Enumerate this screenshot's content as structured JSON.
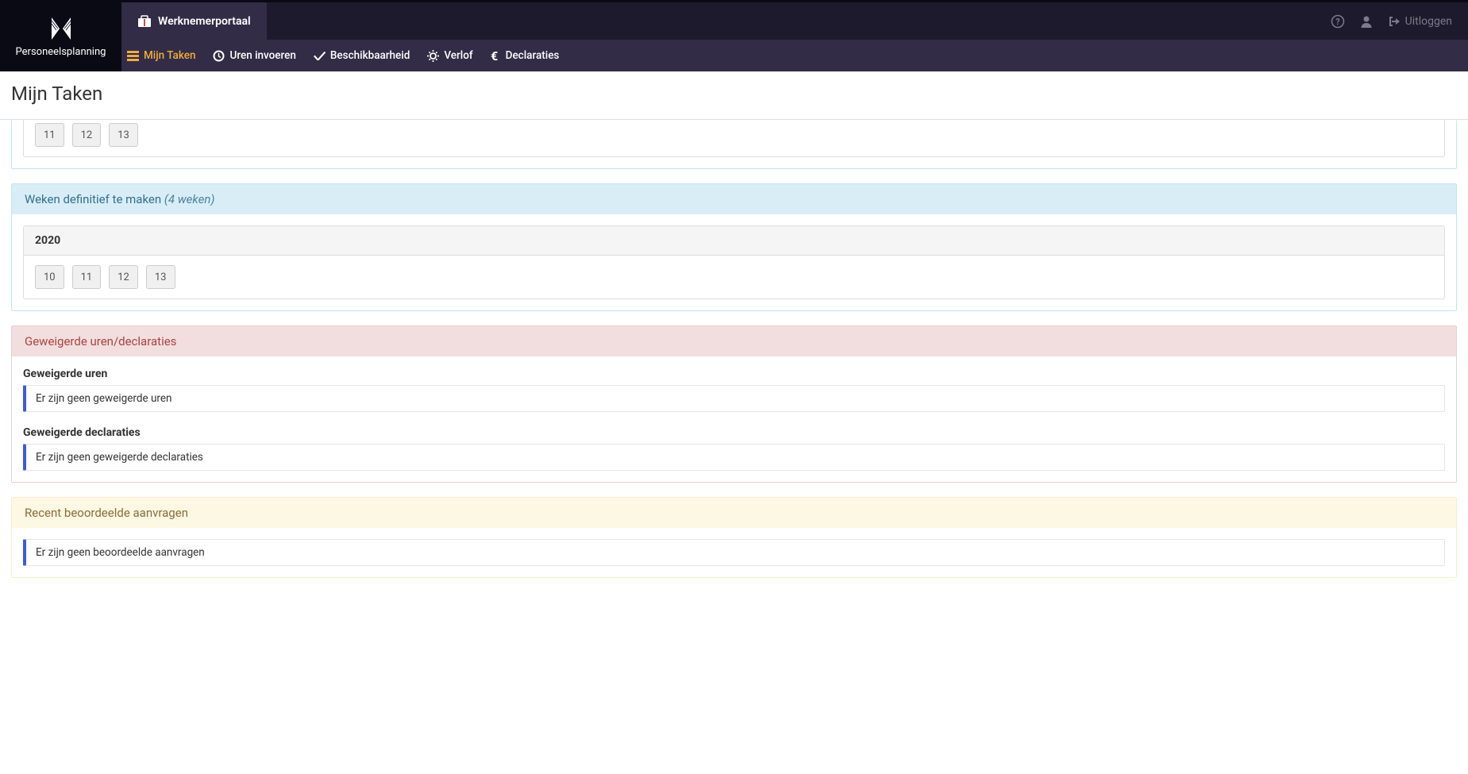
{
  "brand": "Personeelsplanning",
  "portal_tab": "Werknemerportaal",
  "topbar": {
    "logout": "Uitloggen"
  },
  "subnav": [
    {
      "label": "Mijn Taken",
      "icon": "tasks",
      "active": true
    },
    {
      "label": "Uren invoeren",
      "icon": "clock",
      "active": false
    },
    {
      "label": "Beschikbaarheid",
      "icon": "check",
      "active": false
    },
    {
      "label": "Verlof",
      "icon": "sun",
      "active": false
    },
    {
      "label": "Declaraties",
      "icon": "euro",
      "active": false
    }
  ],
  "page_title": "Mijn Taken",
  "top_peek_weeks": [
    "11",
    "12",
    "13"
  ],
  "panels": {
    "weeks_definitive": {
      "title": "Weken definitief te maken",
      "meta": "(4 weken)",
      "year": "2020",
      "weeks": [
        "10",
        "11",
        "12",
        "13"
      ]
    },
    "rejected": {
      "title": "Geweigerde uren/declaraties",
      "hours_heading": "Geweigerde uren",
      "hours_empty": "Er zijn geen geweigerde uren",
      "decl_heading": "Geweigerde declaraties",
      "decl_empty": "Er zijn geen geweigerde declaraties"
    },
    "recent": {
      "title": "Recent beoordeelde aanvragen",
      "empty": "Er zijn geen beoordeelde aanvragen"
    }
  }
}
